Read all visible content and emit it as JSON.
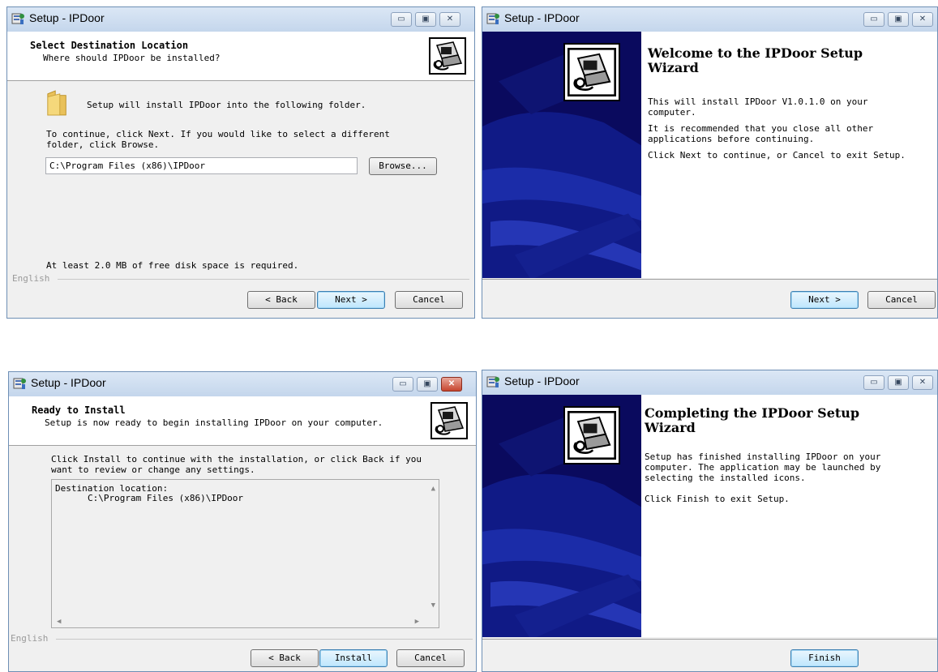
{
  "window_title": "Setup - IPDoor",
  "titlebar_buttons": {
    "minimize": "▭",
    "maximize": "▣",
    "close": "✕"
  },
  "select_destination": {
    "title": "Select Destination Location",
    "subtitle": "Where should IPDoor be installed?",
    "folder_message": "Setup will install IPDoor into the following folder.",
    "instructions": "To continue, click Next. If you would like to select a different\nfolder, click Browse.",
    "path_value": "C:\\Program Files (x86)\\IPDoor",
    "browse_label": "Browse...",
    "disk_space": "At least 2.0 MB of free disk space is required.",
    "language": "English",
    "back_label": "< Back",
    "next_label": "Next >",
    "cancel_label": "Cancel"
  },
  "welcome": {
    "title": "Welcome to the IPDoor Setup\nWizard",
    "p1": "This will install IPDoor V1.0.1.0 on your\ncomputer.",
    "p2": "It is recommended that you close all other\napplications before continuing.",
    "p3": "Click Next to continue, or Cancel to exit Setup.",
    "next_label": "Next >",
    "cancel_label": "Cancel"
  },
  "ready": {
    "title": "Ready to Install",
    "subtitle": "Setup is now ready to begin installing IPDoor on your computer.",
    "instructions": "Click Install to continue with the installation, or click Back if you\nwant to review or change any settings.",
    "memo_label": "Destination location:",
    "memo_value": "C:\\Program Files (x86)\\IPDoor",
    "language": "English",
    "back_label": "< Back",
    "install_label": "Install",
    "cancel_label": "Cancel"
  },
  "completing": {
    "title": "Completing the IPDoor Setup\nWizard",
    "p1": "Setup has finished installing IPDoor on your\ncomputer. The application may be launched by\nselecting the installed icons.",
    "p2": "Click Finish to exit Setup.",
    "finish_label": "Finish"
  },
  "colors": {
    "sidebar": "#0a0a5e",
    "accent": "#3c7fb1"
  },
  "icons": {
    "folder": "folder-icon",
    "setup": "setup-computer-icon",
    "app": "setup-app-icon"
  }
}
